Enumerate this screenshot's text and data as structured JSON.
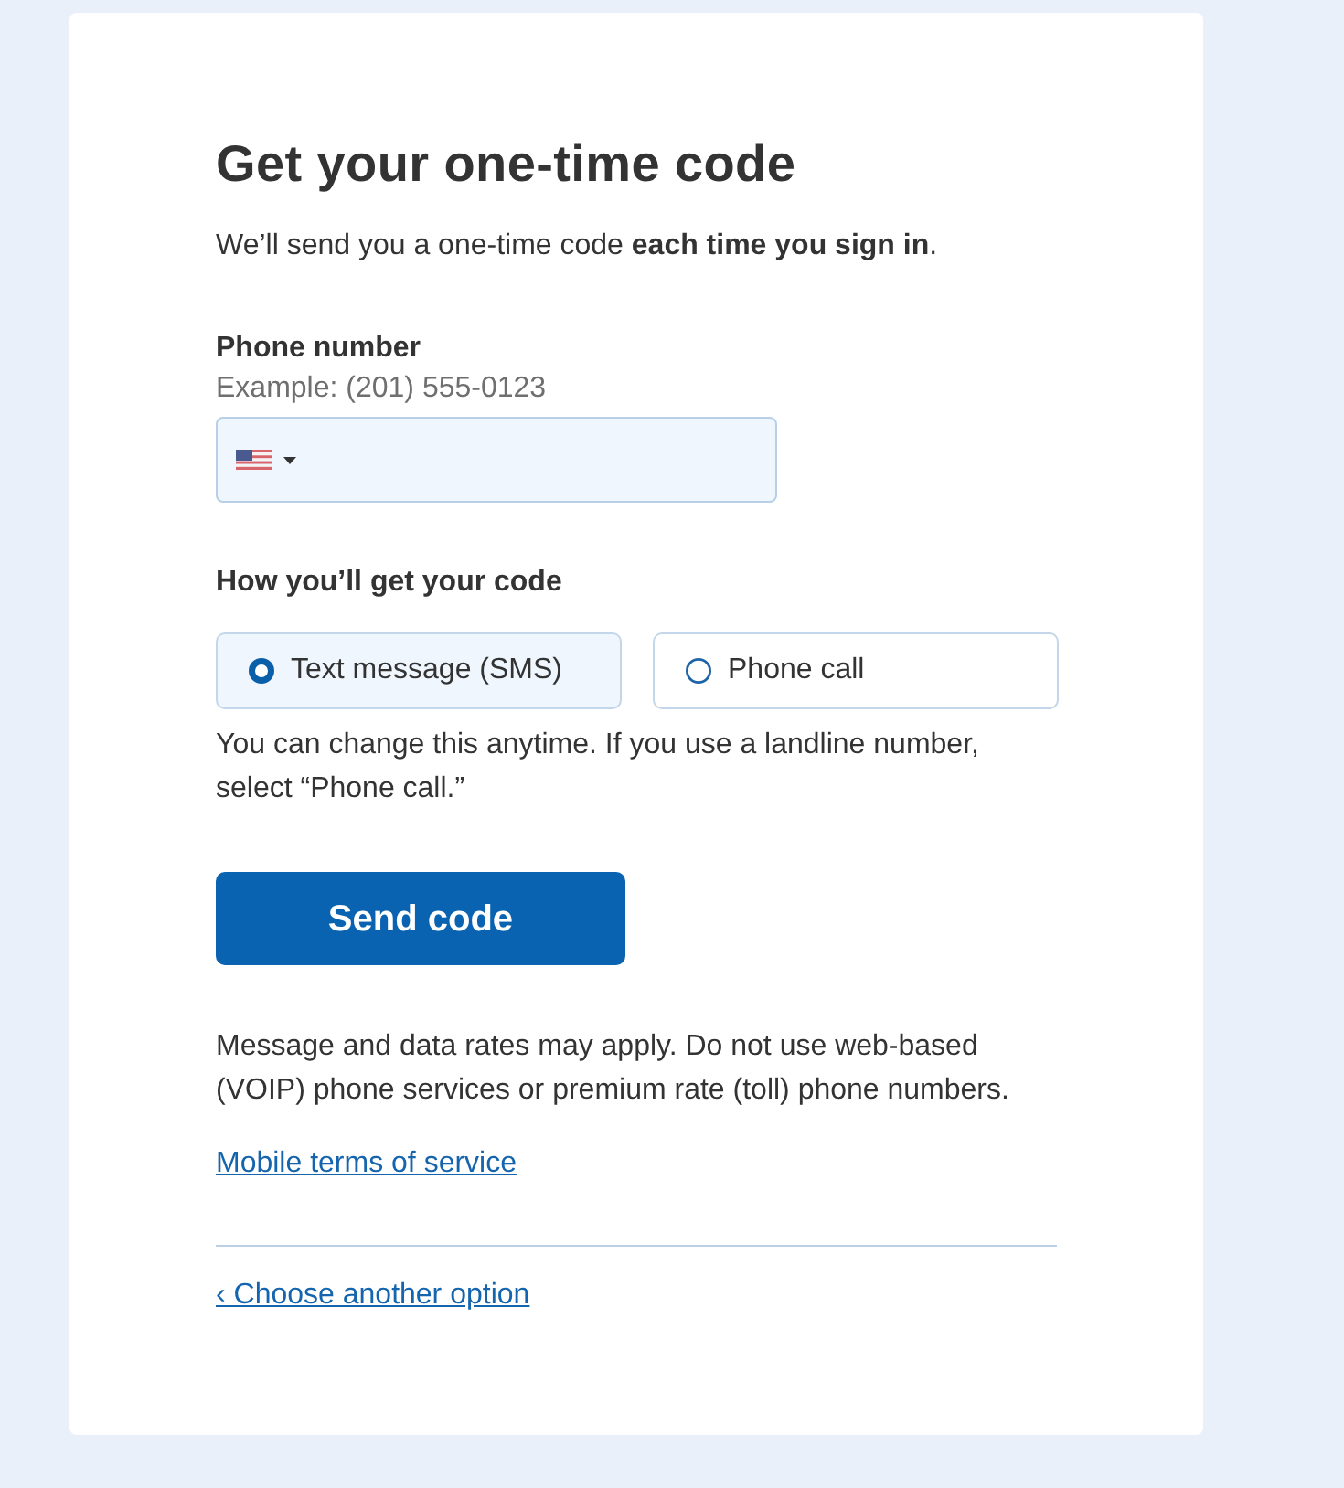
{
  "heading": "Get your one-time code",
  "intro": "We’ll send you a one-time code **each time you sign in**.",
  "phone_number": {
    "label": "Phone number",
    "hint": "Example: (201) 555-0123"
  },
  "delivery": {
    "label": "How you’ll get your code",
    "options": [
      {
        "label": "Text message (SMS)",
        "selected": true
      },
      {
        "label": "Phone call",
        "selected": false
      }
    ],
    "help": "You can change this anytime. If you use a landline number, select “Phone call.”"
  },
  "send_button": "Send code",
  "disclaimer": "Message and data rates may apply. Do not use web-based (VOIP) phone services or premium rate (toll) phone numbers.",
  "terms_link": "Mobile terms of service",
  "back_link": "‹ Choose another option"
}
